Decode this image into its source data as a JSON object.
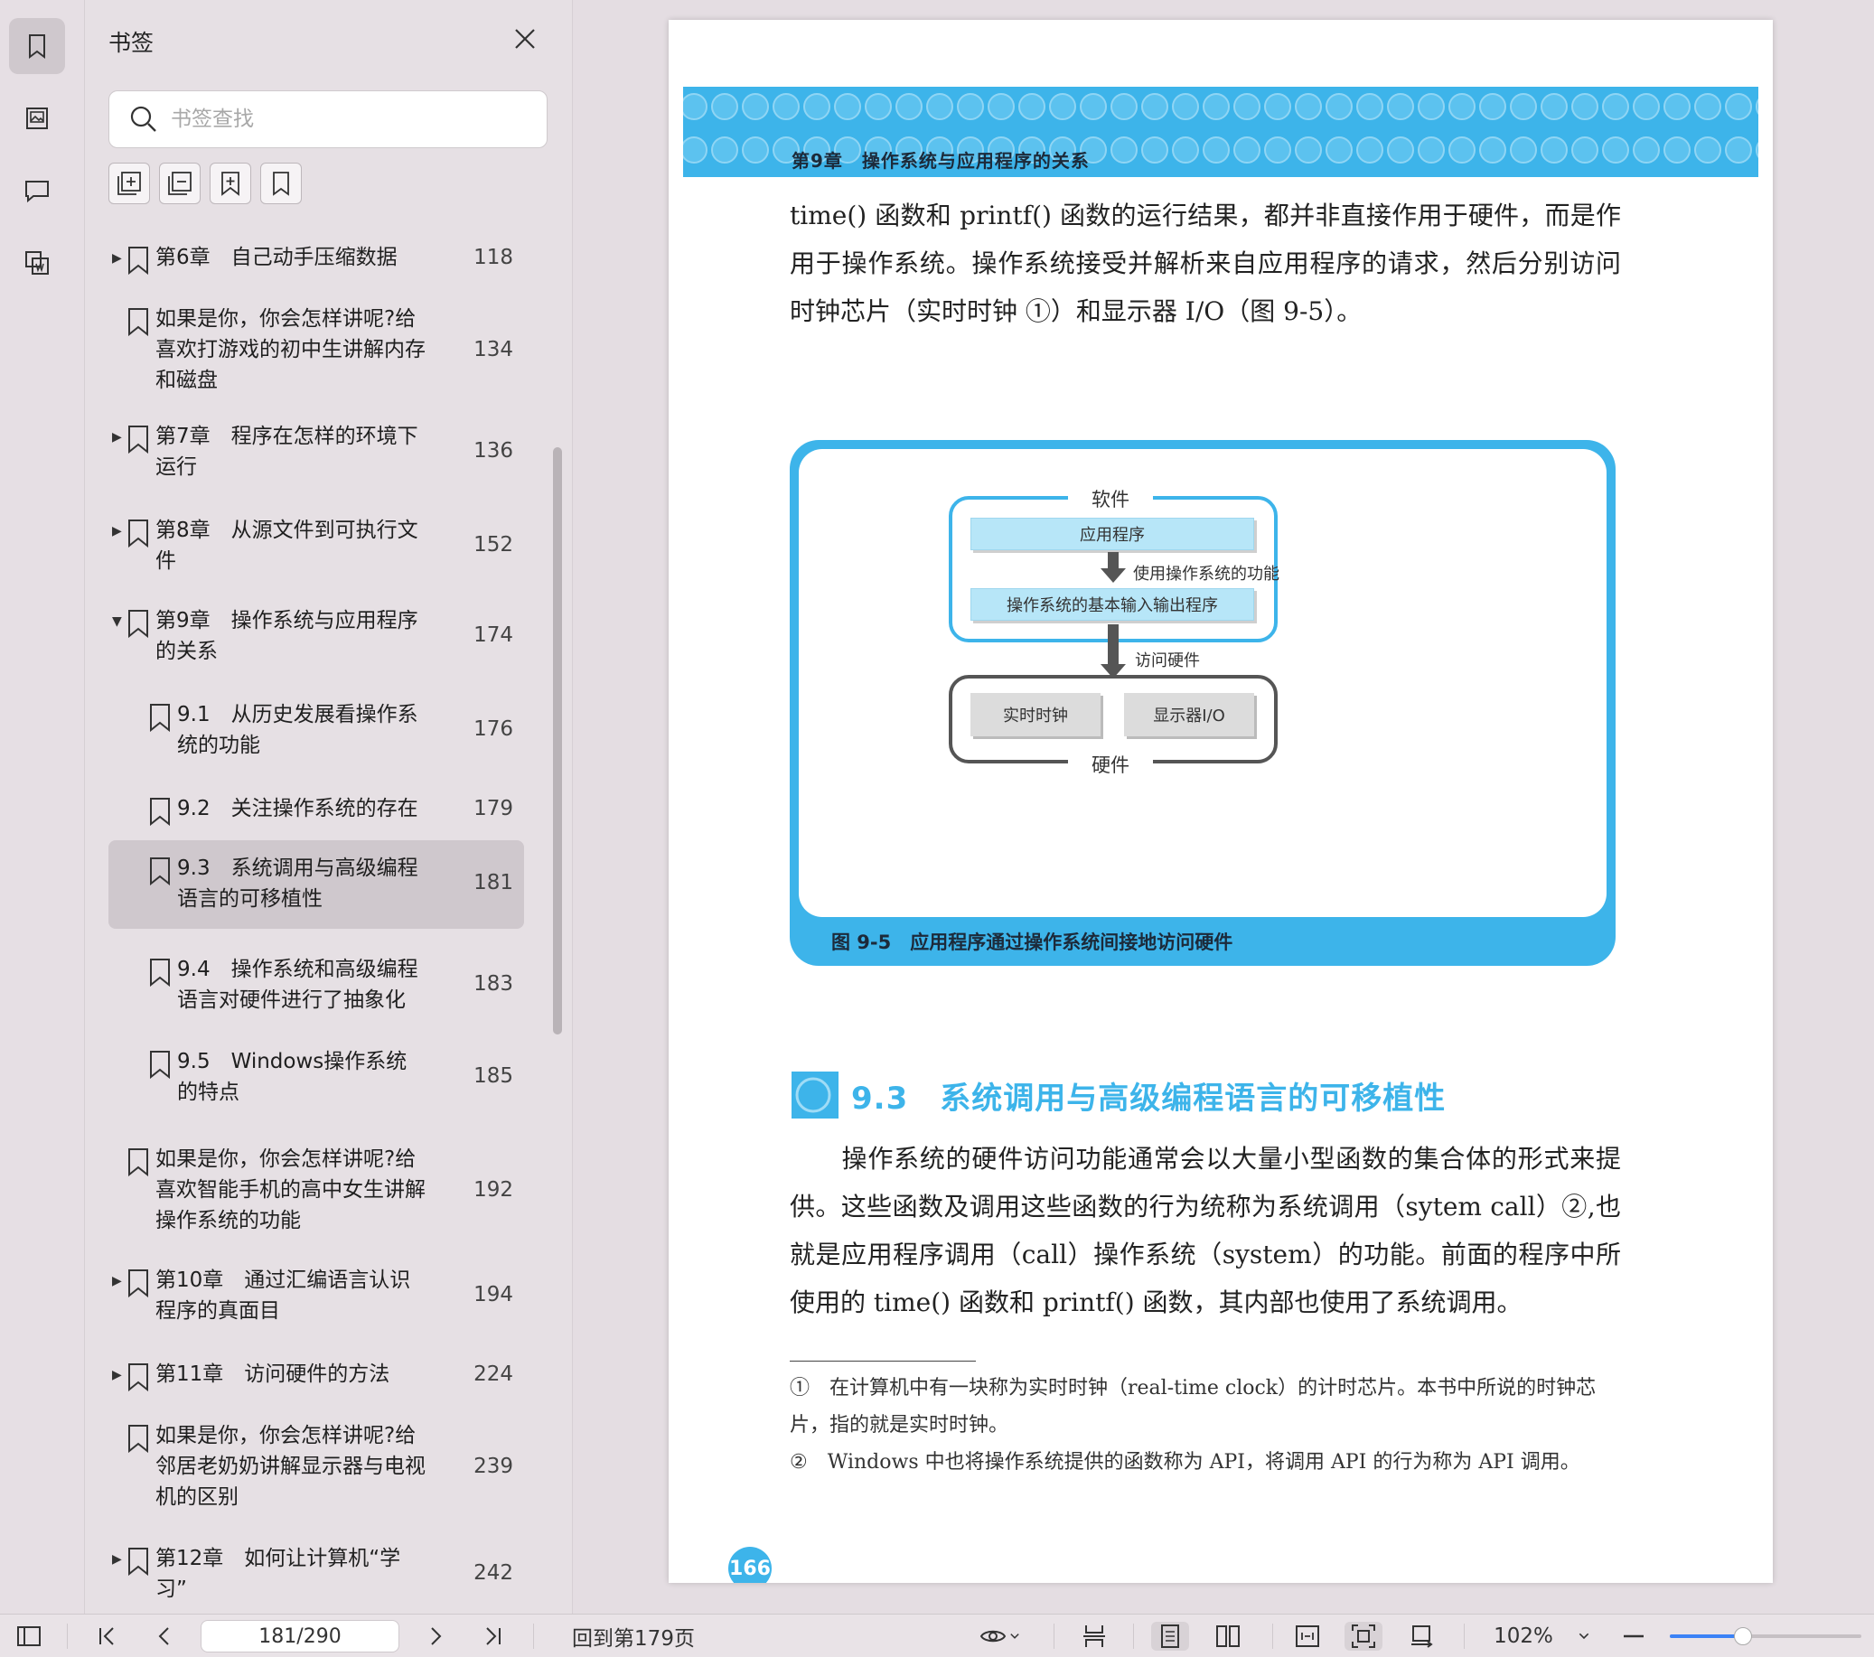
{
  "panel": {
    "title": "书签",
    "search_placeholder": "书签查找"
  },
  "bookmarks": [
    {
      "title": "第6章　自己动手压缩数据",
      "page": "118",
      "expandable": true,
      "expanded": false,
      "level": 0
    },
    {
      "title": "如果是你，你会怎样讲呢?给喜欢打游戏的初中生讲解内存和磁盘",
      "page": "134",
      "expandable": false,
      "level": 0
    },
    {
      "title": "第7章　程序在怎样的环境下运行",
      "page": "136",
      "expandable": true,
      "expanded": false,
      "level": 0
    },
    {
      "title": "第8章　从源文件到可执行文件",
      "page": "152",
      "expandable": true,
      "expanded": false,
      "level": 0
    },
    {
      "title": "第9章　操作系统与应用程序的关系",
      "page": "174",
      "expandable": true,
      "expanded": true,
      "level": 0
    },
    {
      "title": "9.1　从历史发展看操作系统的功能",
      "page": "176",
      "expandable": false,
      "level": 1
    },
    {
      "title": "9.2　关注操作系统的存在",
      "page": "179",
      "expandable": false,
      "level": 1
    },
    {
      "title": "9.3　系统调用与高级编程语言的可移植性",
      "page": "181",
      "expandable": false,
      "level": 1,
      "selected": true
    },
    {
      "title": "9.4　操作系统和高级编程语言对硬件进行了抽象化",
      "page": "183",
      "expandable": false,
      "level": 1
    },
    {
      "title": "9.5　Windows操作系统的特点",
      "page": "185",
      "expandable": false,
      "level": 1
    },
    {
      "title": "如果是你，你会怎样讲呢?给喜欢智能手机的高中女生讲解操作系统的功能",
      "page": "192",
      "expandable": false,
      "level": 0
    },
    {
      "title": "第10章　通过汇编语言认识程序的真面目",
      "page": "194",
      "expandable": true,
      "expanded": false,
      "level": 0
    },
    {
      "title": "第11章　访问硬件的方法",
      "page": "224",
      "expandable": true,
      "expanded": false,
      "level": 0
    },
    {
      "title": "如果是你，你会怎样讲呢?给邻居老奶奶讲解显示器与电视机的区别",
      "page": "239",
      "expandable": false,
      "level": 0
    },
    {
      "title": "第12章　如何让计算机“学习”",
      "page": "242",
      "expandable": true,
      "expanded": false,
      "level": 0
    }
  ],
  "document": {
    "header_text": "第9章　操作系统与应用程序的关系",
    "para1": "time() 函数和 printf() 函数的运行结果，都并非直接作用于硬件，而是作用于操作系统。操作系统接受并解析来自应用程序的请求，然后分别访问时钟芯片（实时时钟 ①）和显示器 I/O（图 9-5）。",
    "figure": {
      "software_label": "软件",
      "app_box": "应用程序",
      "use_os_label": "使用操作系统的功能",
      "bios_box": "操作系统的基本输入输出程序",
      "access_label": "访问硬件",
      "clock_box": "实时时钟",
      "display_box": "显示器I/O",
      "hardware_label": "硬件",
      "caption": "图 9-5　应用程序通过操作系统间接地访问硬件"
    },
    "section_title": "9.3　系统调用与高级编程语言的可移植性",
    "para2": "　　操作系统的硬件访问功能通常会以大量小型函数的集合体的形式来提供。这些函数及调用这些函数的行为统称为系统调用（sytem call）②,也就是应用程序调用（call）操作系统（system）的功能。前面的程序中所使用的 time() 函数和 printf() 函数，其内部也使用了系统调用。",
    "footnote1": "①　在计算机中有一块称为实时时钟（real-time clock）的计时芯片。本书中所说的时钟芯片，指的就是实时时钟。",
    "footnote2": "②　Windows 中也将操作系统提供的函数称为 API，将调用 API 的行为称为 API 调用。",
    "page_number": "166"
  },
  "statusbar": {
    "page_field": "181/290",
    "goto_label": "回到第179页",
    "zoom_label": "102%",
    "zoom_fraction": 0.38
  },
  "colors": {
    "accent": "#3db4ea",
    "selected_bg": "#cfc8cd"
  }
}
